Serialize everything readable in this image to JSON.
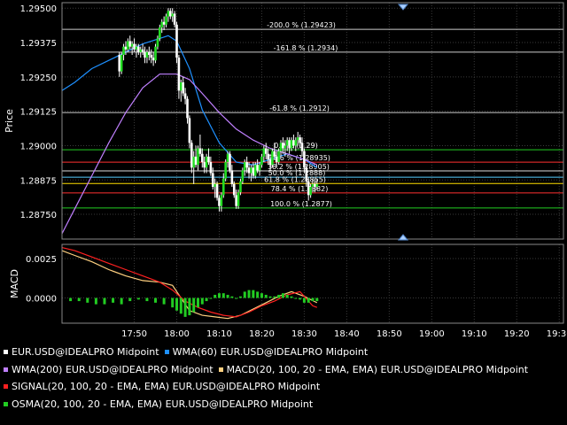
{
  "colors": {
    "background": "#000000",
    "grid": "#3a3a3a",
    "axis": "#888888",
    "text": "#ffffff",
    "bull": "#22dd22",
    "bear": "#ffffff",
    "wick": "#ffffff",
    "wma60": "#1e90ff",
    "wma200": "#c080ff",
    "macd": "#ffd080",
    "signal": "#ff2020",
    "osma": "#22cc22",
    "handle": "#aad0ff",
    "fib_line": "#cccccc",
    "level_zero": "#22cc22",
    "level_red": "#ff3030",
    "level_white": "#dddddd",
    "level_yellow": "#ffdd00",
    "level_cyan": "#55ccff",
    "level_100": "#22cc22"
  },
  "price_panel": {
    "ylabel": "Price",
    "ylim": [
      1.2866,
      1.2952
    ],
    "yticks": [
      "1.29500",
      "1.29375",
      "1.29250",
      "1.29125",
      "1.29000",
      "1.28875",
      "1.28750"
    ],
    "ytick_values": [
      1.295,
      1.29375,
      1.2925,
      1.29125,
      1.29,
      1.28875,
      1.2875
    ]
  },
  "macd_panel": {
    "ylabel": "MACD",
    "ylim": [
      -0.0016,
      0.0034
    ],
    "yticks": [
      "0.0025",
      "0.0000"
    ],
    "ytick_values": [
      0.0025,
      0.0
    ]
  },
  "time_axis": {
    "labels": [
      "17:50",
      "18:00",
      "18:10",
      "18:20",
      "18:30",
      "18:40",
      "18:50",
      "19:00",
      "19:10",
      "19:20",
      "19:30"
    ],
    "start_minute": 1053,
    "end_minute": 1171
  },
  "fib_levels": [
    {
      "label": "-200.0 % (1.29423)",
      "price": 1.29423,
      "color_key": "fib_line"
    },
    {
      "label": "-161.8 % (1.2934)",
      "price": 1.2934,
      "color_key": "fib_line"
    },
    {
      "label": "-61.8 % (1.2912)",
      "price": 1.2912,
      "color_key": "fib_line"
    },
    {
      "label": "0.0 % (1.29)",
      "price": 1.28985,
      "color_key": "level_zero"
    },
    {
      "label": "23.6 % (1.28935)",
      "price": 1.2894,
      "color_key": "level_red"
    },
    {
      "label": "38.2 % (1.28905)",
      "price": 1.28908,
      "color_key": "level_white"
    },
    {
      "label": "50.0 % (1.2888)",
      "price": 1.28885,
      "color_key": "level_cyan"
    },
    {
      "label": "61.8 % (1.28855)",
      "price": 1.28862,
      "color_key": "level_yellow"
    },
    {
      "label": "78.4 % (1.2882)",
      "price": 1.28828,
      "color_key": "level_red"
    },
    {
      "label": "100.0 % (1.2877)",
      "price": 1.28773,
      "color_key": "level_100"
    }
  ],
  "chart_data": {
    "type": "line",
    "title": "",
    "candles": [
      {
        "t": 1066.5,
        "o": 1.2933,
        "h": 1.2934,
        "l": 1.2925,
        "c": 1.2927
      },
      {
        "t": 1067.0,
        "o": 1.2927,
        "h": 1.2934,
        "l": 1.2926,
        "c": 1.2933
      },
      {
        "t": 1067.5,
        "o": 1.2933,
        "h": 1.2937,
        "l": 1.2931,
        "c": 1.2936
      },
      {
        "t": 1068.0,
        "o": 1.2936,
        "h": 1.2938,
        "l": 1.2933,
        "c": 1.2935
      },
      {
        "t": 1068.5,
        "o": 1.2935,
        "h": 1.2939,
        "l": 1.2934,
        "c": 1.2938
      },
      {
        "t": 1069.0,
        "o": 1.2938,
        "h": 1.294,
        "l": 1.2935,
        "c": 1.2936
      },
      {
        "t": 1069.5,
        "o": 1.2936,
        "h": 1.2938,
        "l": 1.2933,
        "c": 1.2937
      },
      {
        "t": 1070.0,
        "o": 1.2937,
        "h": 1.2939,
        "l": 1.2934,
        "c": 1.2935
      },
      {
        "t": 1070.5,
        "o": 1.2935,
        "h": 1.2937,
        "l": 1.2932,
        "c": 1.2936
      },
      {
        "t": 1071.0,
        "o": 1.2936,
        "h": 1.2937,
        "l": 1.2933,
        "c": 1.2934
      },
      {
        "t": 1071.5,
        "o": 1.2934,
        "h": 1.2936,
        "l": 1.2932,
        "c": 1.2935
      },
      {
        "t": 1072.0,
        "o": 1.2935,
        "h": 1.2937,
        "l": 1.2933,
        "c": 1.2934
      },
      {
        "t": 1072.5,
        "o": 1.2934,
        "h": 1.2936,
        "l": 1.293,
        "c": 1.2932
      },
      {
        "t": 1073.0,
        "o": 1.2932,
        "h": 1.2935,
        "l": 1.293,
        "c": 1.2934
      },
      {
        "t": 1073.5,
        "o": 1.2934,
        "h": 1.2936,
        "l": 1.2931,
        "c": 1.2933
      },
      {
        "t": 1074.0,
        "o": 1.2933,
        "h": 1.2935,
        "l": 1.293,
        "c": 1.2932
      },
      {
        "t": 1074.5,
        "o": 1.2932,
        "h": 1.2934,
        "l": 1.2929,
        "c": 1.2931
      },
      {
        "t": 1075.0,
        "o": 1.2931,
        "h": 1.2937,
        "l": 1.293,
        "c": 1.2936
      },
      {
        "t": 1075.5,
        "o": 1.2936,
        "h": 1.294,
        "l": 1.2935,
        "c": 1.2939
      },
      {
        "t": 1076.0,
        "o": 1.2939,
        "h": 1.2944,
        "l": 1.2938,
        "c": 1.2943
      },
      {
        "t": 1076.5,
        "o": 1.2943,
        "h": 1.2946,
        "l": 1.2941,
        "c": 1.2945
      },
      {
        "t": 1077.0,
        "o": 1.2945,
        "h": 1.2947,
        "l": 1.2942,
        "c": 1.2944
      },
      {
        "t": 1077.5,
        "o": 1.2944,
        "h": 1.2948,
        "l": 1.2943,
        "c": 1.2947
      },
      {
        "t": 1078.0,
        "o": 1.2947,
        "h": 1.295,
        "l": 1.2945,
        "c": 1.2949
      },
      {
        "t": 1078.5,
        "o": 1.2949,
        "h": 1.295,
        "l": 1.2946,
        "c": 1.2947
      },
      {
        "t": 1079.0,
        "o": 1.2947,
        "h": 1.295,
        "l": 1.2945,
        "c": 1.2948
      },
      {
        "t": 1079.5,
        "o": 1.2948,
        "h": 1.2949,
        "l": 1.2943,
        "c": 1.2944
      },
      {
        "t": 1080.0,
        "o": 1.2944,
        "h": 1.2945,
        "l": 1.293,
        "c": 1.2932
      },
      {
        "t": 1080.5,
        "o": 1.2932,
        "h": 1.2933,
        "l": 1.2917,
        "c": 1.292
      },
      {
        "t": 1081.0,
        "o": 1.292,
        "h": 1.2924,
        "l": 1.2916,
        "c": 1.2923
      },
      {
        "t": 1081.5,
        "o": 1.2923,
        "h": 1.2925,
        "l": 1.2918,
        "c": 1.2919
      },
      {
        "t": 1082.0,
        "o": 1.2919,
        "h": 1.2921,
        "l": 1.2915,
        "c": 1.2917
      },
      {
        "t": 1082.5,
        "o": 1.2917,
        "h": 1.2918,
        "l": 1.2908,
        "c": 1.291
      },
      {
        "t": 1083.0,
        "o": 1.291,
        "h": 1.2911,
        "l": 1.2899,
        "c": 1.2901
      },
      {
        "t": 1083.5,
        "o": 1.2901,
        "h": 1.2902,
        "l": 1.289,
        "c": 1.2892
      },
      {
        "t": 1084.0,
        "o": 1.2892,
        "h": 1.2898,
        "l": 1.2886,
        "c": 1.2896
      },
      {
        "t": 1084.5,
        "o": 1.2896,
        "h": 1.29,
        "l": 1.2892,
        "c": 1.2893
      },
      {
        "t": 1085.0,
        "o": 1.2893,
        "h": 1.29,
        "l": 1.2891,
        "c": 1.2899
      },
      {
        "t": 1085.5,
        "o": 1.2899,
        "h": 1.2904,
        "l": 1.2896,
        "c": 1.2897
      },
      {
        "t": 1086.0,
        "o": 1.2897,
        "h": 1.2899,
        "l": 1.2892,
        "c": 1.2894
      },
      {
        "t": 1086.5,
        "o": 1.2894,
        "h": 1.2896,
        "l": 1.289,
        "c": 1.2892
      },
      {
        "t": 1087.0,
        "o": 1.2892,
        "h": 1.2897,
        "l": 1.289,
        "c": 1.2896
      },
      {
        "t": 1087.5,
        "o": 1.2896,
        "h": 1.2899,
        "l": 1.2893,
        "c": 1.2894
      },
      {
        "t": 1088.0,
        "o": 1.2894,
        "h": 1.2896,
        "l": 1.2889,
        "c": 1.289
      },
      {
        "t": 1088.5,
        "o": 1.289,
        "h": 1.2892,
        "l": 1.2884,
        "c": 1.2885
      },
      {
        "t": 1089.0,
        "o": 1.2885,
        "h": 1.2888,
        "l": 1.2881,
        "c": 1.2886
      },
      {
        "t": 1089.5,
        "o": 1.2886,
        "h": 1.2887,
        "l": 1.288,
        "c": 1.2881
      },
      {
        "t": 1090.0,
        "o": 1.2881,
        "h": 1.2882,
        "l": 1.2876,
        "c": 1.2878
      },
      {
        "t": 1090.5,
        "o": 1.2878,
        "h": 1.2883,
        "l": 1.2876,
        "c": 1.2882
      },
      {
        "t": 1091.0,
        "o": 1.2882,
        "h": 1.289,
        "l": 1.2881,
        "c": 1.2888
      },
      {
        "t": 1091.5,
        "o": 1.2888,
        "h": 1.2895,
        "l": 1.2887,
        "c": 1.2894
      },
      {
        "t": 1092.0,
        "o": 1.2894,
        "h": 1.2898,
        "l": 1.2892,
        "c": 1.2897
      },
      {
        "t": 1092.5,
        "o": 1.2897,
        "h": 1.2898,
        "l": 1.289,
        "c": 1.2891
      },
      {
        "t": 1093.0,
        "o": 1.2891,
        "h": 1.2893,
        "l": 1.2885,
        "c": 1.2886
      },
      {
        "t": 1093.5,
        "o": 1.2886,
        "h": 1.2887,
        "l": 1.2881,
        "c": 1.2882
      },
      {
        "t": 1094.0,
        "o": 1.2882,
        "h": 1.2884,
        "l": 1.2877,
        "c": 1.2878
      },
      {
        "t": 1094.5,
        "o": 1.2878,
        "h": 1.2884,
        "l": 1.2877,
        "c": 1.2883
      },
      {
        "t": 1095.0,
        "o": 1.2883,
        "h": 1.2888,
        "l": 1.2882,
        "c": 1.2887
      },
      {
        "t": 1095.5,
        "o": 1.2887,
        "h": 1.2892,
        "l": 1.2886,
        "c": 1.2891
      },
      {
        "t": 1096.0,
        "o": 1.2891,
        "h": 1.2895,
        "l": 1.2889,
        "c": 1.2894
      },
      {
        "t": 1096.5,
        "o": 1.2894,
        "h": 1.2896,
        "l": 1.289,
        "c": 1.2892
      },
      {
        "t": 1097.0,
        "o": 1.2892,
        "h": 1.2894,
        "l": 1.2888,
        "c": 1.289
      },
      {
        "t": 1097.5,
        "o": 1.289,
        "h": 1.2893,
        "l": 1.2887,
        "c": 1.2892
      },
      {
        "t": 1098.0,
        "o": 1.2892,
        "h": 1.2894,
        "l": 1.2888,
        "c": 1.2889
      },
      {
        "t": 1098.5,
        "o": 1.2889,
        "h": 1.2894,
        "l": 1.2888,
        "c": 1.2893
      },
      {
        "t": 1099.0,
        "o": 1.2893,
        "h": 1.2895,
        "l": 1.289,
        "c": 1.2891
      },
      {
        "t": 1099.5,
        "o": 1.2891,
        "h": 1.2894,
        "l": 1.2889,
        "c": 1.2893
      },
      {
        "t": 1100.0,
        "o": 1.2893,
        "h": 1.2897,
        "l": 1.2892,
        "c": 1.2896
      },
      {
        "t": 1100.5,
        "o": 1.2896,
        "h": 1.29,
        "l": 1.2894,
        "c": 1.2899
      },
      {
        "t": 1101.0,
        "o": 1.2899,
        "h": 1.2901,
        "l": 1.2895,
        "c": 1.2897
      },
      {
        "t": 1101.5,
        "o": 1.2897,
        "h": 1.2899,
        "l": 1.2893,
        "c": 1.2895
      },
      {
        "t": 1102.0,
        "o": 1.2895,
        "h": 1.2897,
        "l": 1.2891,
        "c": 1.2893
      },
      {
        "t": 1102.5,
        "o": 1.2893,
        "h": 1.2899,
        "l": 1.2892,
        "c": 1.2898
      },
      {
        "t": 1103.0,
        "o": 1.2898,
        "h": 1.2901,
        "l": 1.2895,
        "c": 1.2896
      },
      {
        "t": 1103.5,
        "o": 1.2896,
        "h": 1.2898,
        "l": 1.2892,
        "c": 1.2894
      },
      {
        "t": 1104.0,
        "o": 1.2894,
        "h": 1.2899,
        "l": 1.2893,
        "c": 1.2898
      },
      {
        "t": 1104.5,
        "o": 1.2898,
        "h": 1.2902,
        "l": 1.2896,
        "c": 1.2901
      },
      {
        "t": 1105.0,
        "o": 1.2901,
        "h": 1.2903,
        "l": 1.2897,
        "c": 1.2899
      },
      {
        "t": 1105.5,
        "o": 1.2899,
        "h": 1.2902,
        "l": 1.2896,
        "c": 1.29
      },
      {
        "t": 1106.0,
        "o": 1.29,
        "h": 1.2903,
        "l": 1.2898,
        "c": 1.2902
      },
      {
        "t": 1106.5,
        "o": 1.2902,
        "h": 1.2903,
        "l": 1.2897,
        "c": 1.2899
      },
      {
        "t": 1107.0,
        "o": 1.2899,
        "h": 1.2903,
        "l": 1.2898,
        "c": 1.2902
      },
      {
        "t": 1107.5,
        "o": 1.2902,
        "h": 1.2904,
        "l": 1.2899,
        "c": 1.29
      },
      {
        "t": 1108.0,
        "o": 1.29,
        "h": 1.2903,
        "l": 1.2898,
        "c": 1.2902
      },
      {
        "t": 1108.5,
        "o": 1.2902,
        "h": 1.2905,
        "l": 1.29,
        "c": 1.2903
      },
      {
        "t": 1109.0,
        "o": 1.2903,
        "h": 1.2904,
        "l": 1.2899,
        "c": 1.2901
      },
      {
        "t": 1109.5,
        "o": 1.2901,
        "h": 1.2903,
        "l": 1.2896,
        "c": 1.2898
      },
      {
        "t": 1110.0,
        "o": 1.2898,
        "h": 1.2899,
        "l": 1.289,
        "c": 1.2892
      },
      {
        "t": 1110.5,
        "o": 1.2892,
        "h": 1.2893,
        "l": 1.2885,
        "c": 1.2887
      },
      {
        "t": 1111.0,
        "o": 1.2887,
        "h": 1.2888,
        "l": 1.288,
        "c": 1.2882
      },
      {
        "t": 1111.5,
        "o": 1.2882,
        "h": 1.2886,
        "l": 1.2881,
        "c": 1.2885
      },
      {
        "t": 1112.0,
        "o": 1.2885,
        "h": 1.2888,
        "l": 1.2883,
        "c": 1.2886
      },
      {
        "t": 1112.5,
        "o": 1.2886,
        "h": 1.2888,
        "l": 1.2883,
        "c": 1.2885
      },
      {
        "t": 1113.0,
        "o": 1.2885,
        "h": 1.2888,
        "l": 1.2884,
        "c": 1.2886
      }
    ],
    "series": [
      {
        "name": "WMA(60) EUR.USD@IDEALPRO Midpoint",
        "color_key": "wma60",
        "x": [
          1053,
          1056,
          1060,
          1064,
          1068,
          1072,
          1076,
          1078,
          1080,
          1083,
          1086,
          1090,
          1094,
          1098,
          1102,
          1106,
          1110,
          1113
        ],
        "y": [
          1.292,
          1.2923,
          1.2928,
          1.2931,
          1.2934,
          1.2937,
          1.2939,
          1.294,
          1.2938,
          1.2928,
          1.2913,
          1.2901,
          1.2894,
          1.2893,
          1.2895,
          1.2897,
          1.2895,
          1.2892
        ]
      },
      {
        "name": "WMA(200) EUR.USD@IDEALPRO Midpoint",
        "color_key": "wma200",
        "x": [
          1053,
          1056,
          1060,
          1064,
          1068,
          1072,
          1076,
          1080,
          1083,
          1086,
          1090,
          1094,
          1098,
          1102,
          1106,
          1110,
          1113
        ],
        "y": [
          1.2868,
          1.2877,
          1.2889,
          1.2901,
          1.2912,
          1.2921,
          1.2926,
          1.2926,
          1.2924,
          1.2919,
          1.2912,
          1.2906,
          1.2902,
          1.2899,
          1.2897,
          1.2895,
          1.2893
        ]
      },
      {
        "name": "MACD(20, 100, 20 - EMA, EMA) EUR.USD@IDEALPRO Midpoint",
        "color_key": "macd",
        "x": [
          1053,
          1056,
          1060,
          1064,
          1068,
          1072,
          1076,
          1079,
          1081,
          1083,
          1086,
          1089,
          1092,
          1095,
          1098,
          1101,
          1104,
          1107,
          1110,
          1113
        ],
        "y": [
          0.003,
          0.0027,
          0.0023,
          0.0018,
          0.0014,
          0.0011,
          0.001,
          0.0008,
          0.0,
          -0.0008,
          -0.0011,
          -0.0012,
          -0.0013,
          -0.0011,
          -0.0007,
          -0.0003,
          0.0001,
          0.0004,
          0.0001,
          -0.0003
        ]
      },
      {
        "name": "SIGNAL(20, 100, 20 - EMA, EMA) EUR.USD@IDEALPRO Midpoint",
        "color_key": "signal",
        "x": [
          1053,
          1056,
          1060,
          1064,
          1068,
          1072,
          1076,
          1079,
          1082,
          1085,
          1088,
          1091,
          1094,
          1097,
          1100,
          1103,
          1106,
          1109,
          1112,
          1113
        ],
        "y": [
          0.0032,
          0.003,
          0.0026,
          0.0022,
          0.0018,
          0.0014,
          0.001,
          0.0005,
          -0.0002,
          -0.0006,
          -0.0009,
          -0.0011,
          -0.0012,
          -0.0009,
          -0.0005,
          -0.0002,
          0.0002,
          0.0004,
          -0.0005,
          -0.0006
        ]
      },
      {
        "name": "OSMA(20, 100, 20 - EMA, EMA) EUR.USD@IDEALPRO Midpoint",
        "color_key": "osma",
        "kind": "bar",
        "x": [
          1055,
          1057,
          1059,
          1061,
          1063,
          1065,
          1067,
          1069,
          1071,
          1073,
          1075,
          1077,
          1079,
          1080,
          1081,
          1082,
          1083,
          1084,
          1085,
          1086,
          1087,
          1088,
          1089,
          1090,
          1091,
          1092,
          1093,
          1094,
          1095,
          1096,
          1097,
          1098,
          1099,
          1100,
          1101,
          1102,
          1103,
          1104,
          1105,
          1106,
          1107,
          1108,
          1109,
          1110,
          1111,
          1112,
          1113
        ],
        "y": [
          -0.0002,
          -0.0002,
          -0.0003,
          -0.0004,
          -0.0004,
          -0.0003,
          -0.0004,
          -0.0002,
          -0.0001,
          -0.0002,
          -0.0003,
          -0.0004,
          -0.0006,
          -0.0008,
          -0.001,
          -0.0012,
          -0.0011,
          -0.0009,
          -0.0006,
          -0.0004,
          -0.0002,
          0.0,
          0.0002,
          0.0003,
          0.0003,
          0.0002,
          0.0001,
          0.0,
          0.0001,
          0.0004,
          0.0005,
          0.0005,
          0.0004,
          0.0003,
          0.0002,
          0.0001,
          0.0001,
          0.0002,
          0.0003,
          0.0002,
          0.0001,
          0.0,
          -0.0001,
          -0.0003,
          -0.0003,
          -0.0002,
          -0.0002
        ]
      }
    ]
  },
  "legend": [
    [
      {
        "label": "EUR.USD@IDEALPRO Midpoint",
        "color_key": "text"
      },
      {
        "label": "WMA(60) EUR.USD@IDEALPRO Midpoint",
        "color_key": "wma60"
      }
    ],
    [
      {
        "label": "WMA(200) EUR.USD@IDEALPRO Midpoint",
        "color_key": "wma200"
      },
      {
        "label": "MACD(20, 100, 20 - EMA, EMA) EUR.USD@IDEALPRO Midpoint",
        "color_key": "macd"
      }
    ],
    [
      {
        "label": "SIGNAL(20, 100, 20 - EMA, EMA) EUR.USD@IDEALPRO Midpoint",
        "color_key": "signal"
      }
    ],
    [
      {
        "label": "OSMA(20, 100, 20 - EMA, EMA) EUR.USD@IDEALPRO Midpoint",
        "color_key": "osma"
      }
    ]
  ]
}
